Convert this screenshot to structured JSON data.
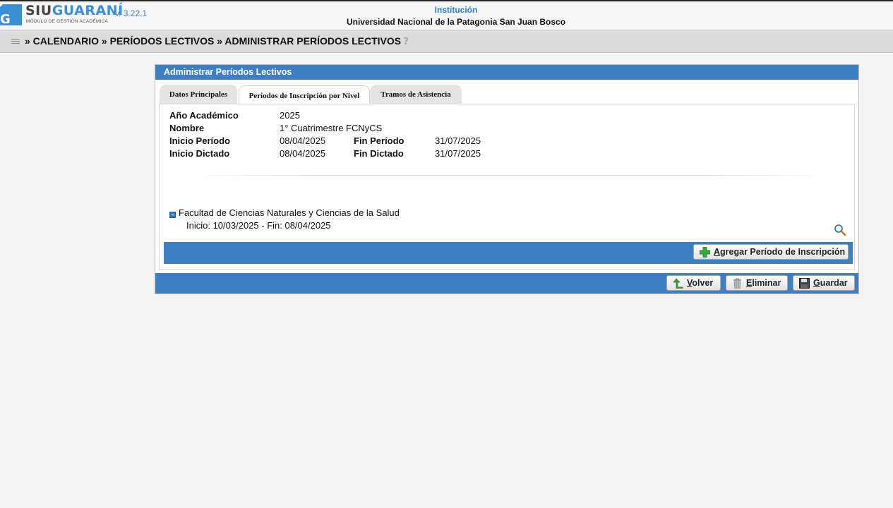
{
  "app": {
    "logo_siu": "SIU",
    "logo_guarani": "GUARANÍ",
    "logo_subtitle": "MÓDULO DE GESTIÓN ACADÉMICA",
    "version": "v. 3.22.1",
    "institution_label": "Institución",
    "institution_name": "Universidad Nacional de la Patagonia San Juan Bosco"
  },
  "breadcrumb": {
    "text": "» CALENDARIO » PERÍODOS LECTIVOS » ADMINISTRAR PERÍODOS LECTIVOS",
    "help": "?"
  },
  "panel": {
    "title": "Administrar Períodos Lectivos",
    "tabs": [
      {
        "label": "Datos Principales",
        "active": false
      },
      {
        "label": "Períodos de Inscripción por Nivel",
        "active": true
      },
      {
        "label": "Tramos de Asistencia",
        "active": false
      }
    ]
  },
  "details": {
    "anio_label": "Año Académico",
    "anio_value": "2025",
    "nombre_label": "Nombre",
    "nombre_value": "1° Cuatrimestre FCNyCS",
    "inicio_periodo_label": "Inicio Período",
    "inicio_periodo_value": "08/04/2025",
    "fin_periodo_label": "Fin Período",
    "fin_periodo_value": "31/07/2025",
    "inicio_dictado_label": "Inicio Dictado",
    "inicio_dictado_value": "08/04/2025",
    "fin_dictado_label": "Fin Dictado",
    "fin_dictado_value": "31/07/2025"
  },
  "tree": {
    "faculty": "Facultad de Ciencias Naturales y Ciencias de la Salud",
    "dates": "Inicio: 10/03/2025 - Fin: 08/04/2025"
  },
  "buttons": {
    "add_first": "A",
    "add_rest": "gregar Período de Inscripción",
    "volver_first": "V",
    "volver_rest": "olver",
    "eliminar_first": "E",
    "eliminar_rest": "liminar",
    "guardar_first": "G",
    "guardar_rest": "uardar"
  },
  "icons": {
    "logo": "siu-guarani-logo-icon",
    "menu": "list-menu-icon",
    "help": "help-icon",
    "collapse": "collapse-minus-icon",
    "zoom": "magnifier-icon",
    "add": "green-plus-icon",
    "back": "green-arrow-back-icon",
    "delete": "trash-icon",
    "save": "floppy-disk-icon"
  },
  "colors": {
    "accent_blue": "#3f7fc1",
    "link_blue": "#2a7fc8",
    "logo_blue": "#3a8fd6"
  }
}
